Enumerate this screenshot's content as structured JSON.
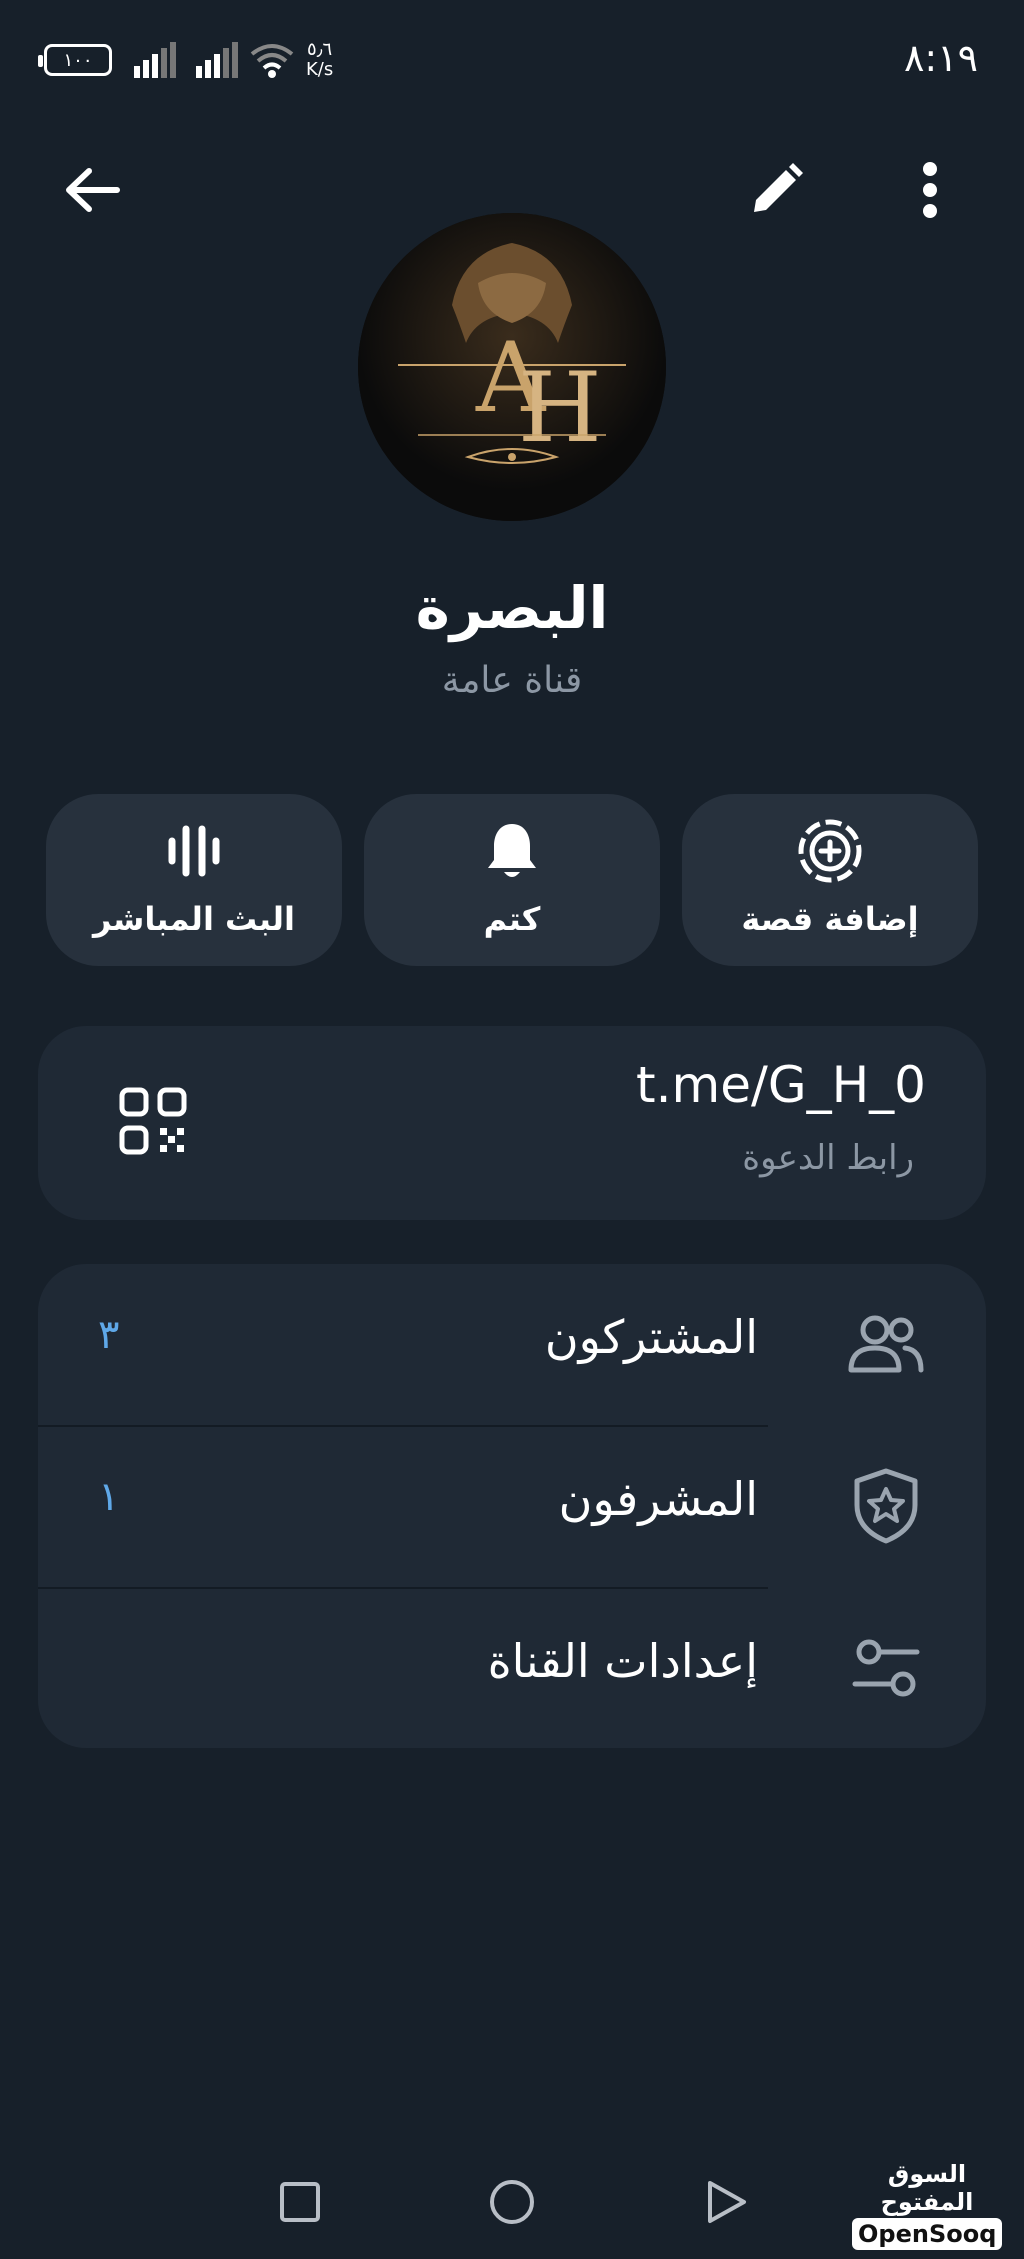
{
  "status_bar": {
    "time": "٨:١٩",
    "battery": "١٠٠",
    "net_speed_value": "٥٫٦",
    "net_speed_unit": "K/s"
  },
  "header": {
    "back_icon": "arrow-left-icon",
    "edit_icon": "pencil-icon",
    "menu_icon": "more-vertical-icon"
  },
  "profile": {
    "name": "البصرة",
    "type": "قناة عامة"
  },
  "actions": [
    {
      "label": "إضافة قصة",
      "icon": "add-story-icon"
    },
    {
      "label": "كتم",
      "icon": "bell-icon"
    },
    {
      "label": "البث المباشر",
      "icon": "live-stream-icon"
    }
  ],
  "invite": {
    "link": "t.me/G_H_0",
    "label": "رابط الدعوة",
    "icon": "qr-code-icon"
  },
  "settings_list": [
    {
      "label": "المشتركون",
      "count": "٣",
      "icon": "users-icon"
    },
    {
      "label": "المشرفون",
      "count": "١",
      "icon": "shield-star-icon"
    },
    {
      "label": "إعدادات القناة",
      "count": "",
      "icon": "sliders-icon"
    }
  ],
  "watermark": {
    "arabic": "السوق المفتوح",
    "english": "OpenSooq"
  },
  "colors": {
    "background": "#17202a",
    "card": "#1f2935",
    "action_button": "#27313d",
    "accent": "#5fa8e8",
    "secondary_text": "#8c97a4"
  }
}
